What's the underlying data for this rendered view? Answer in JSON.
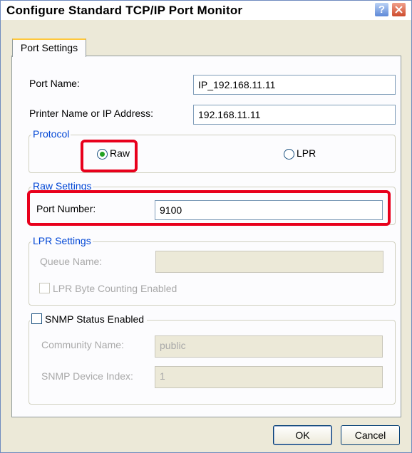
{
  "window": {
    "title": "Configure Standard TCP/IP Port Monitor"
  },
  "titlebar": {
    "help_glyph": "?"
  },
  "tabs": [
    {
      "label": "Port Settings"
    }
  ],
  "fields": {
    "port_name_label": "Port Name:",
    "port_name_value": "IP_192.168.11.11",
    "printer_label": "Printer Name or IP Address:",
    "printer_value": "192.168.11.11"
  },
  "protocol": {
    "legend": "Protocol",
    "raw_label": "Raw",
    "lpr_label": "LPR",
    "selected": "Raw"
  },
  "raw_settings": {
    "legend": "Raw Settings",
    "port_number_label": "Port Number:",
    "port_number_value": "9100"
  },
  "lpr_settings": {
    "legend": "LPR Settings",
    "queue_name_label": "Queue Name:",
    "queue_name_value": "",
    "byte_counting_label": "LPR Byte Counting Enabled"
  },
  "snmp": {
    "legend": "SNMP Status Enabled",
    "community_label": "Community Name:",
    "community_value": "public",
    "device_index_label": "SNMP Device Index:",
    "device_index_value": "1"
  },
  "buttons": {
    "ok": "OK",
    "cancel": "Cancel"
  },
  "colors": {
    "highlight": "#e8001c",
    "group_legend": "#0046d5",
    "dialog_bg": "#ece9d8"
  }
}
